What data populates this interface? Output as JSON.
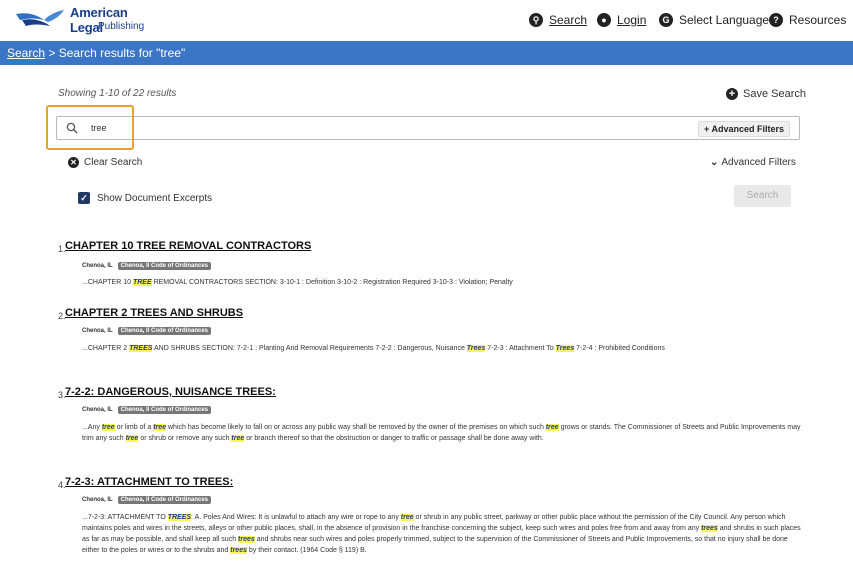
{
  "header": {
    "logo_line1": "American Legal",
    "logo_line2": "Publishing",
    "nav": {
      "search": "Search",
      "login": "Login",
      "language": "Select Language",
      "resources": "Resources"
    }
  },
  "breadcrumb": {
    "link": "Search",
    "separator": " > ",
    "current": "Search results for \"tree\""
  },
  "search": {
    "showing": "Showing 1-10 of 22 results",
    "save_label": "Save Search",
    "query": "tree",
    "advanced_filters_button": "+ Advanced Filters",
    "clear_label": "Clear Search",
    "advanced_filters_toggle": "Advanced Filters",
    "show_excerpts_label": "Show Document Excerpts",
    "show_excerpts_checked": true,
    "search_button": "Search"
  },
  "results": [
    {
      "num": "1.",
      "title": "CHAPTER 10 TREE REMOVAL CONTRACTORS",
      "place": "Chenoa, IL",
      "code": "Chenoa, Il Code of Ordinances",
      "excerpt": [
        {
          "t": "...CHAPTER 10 "
        },
        {
          "h": "TREE"
        },
        {
          "t": " REMOVAL CONTRACTORS SECTION: 3-10-1 : Definition 3-10-2 : Registration Required 3-10-3 : Violation; Penalty"
        }
      ]
    },
    {
      "num": "2.",
      "title": "CHAPTER 2 TREES AND SHRUBS",
      "place": "Chenoa, IL",
      "code": "Chenoa, Il Code of Ordinances",
      "excerpt": [
        {
          "t": "...CHAPTER 2 "
        },
        {
          "h": "TREES"
        },
        {
          "t": " AND SHRUBS SECTION: 7-2-1 : Planting And Removal Requirements 7-2-2 : Dangerous, Nuisance "
        },
        {
          "h": "Trees"
        },
        {
          "t": " 7-2-3 : Attachment To "
        },
        {
          "h": "Trees"
        },
        {
          "t": " 7-2-4 : Prohibited Conditions"
        }
      ]
    },
    {
      "num": "3.",
      "title": "7-2-2: DANGEROUS, NUISANCE TREES:",
      "place": "Chenoa, IL",
      "code": "Chenoa, Il Code of Ordinances",
      "excerpt": [
        {
          "t": "...Any "
        },
        {
          "h": "tree"
        },
        {
          "t": " or limb of a "
        },
        {
          "h": "tree"
        },
        {
          "t": " which has become likely to fall on or across any public way shall be removed by the owner of the premises on which such "
        },
        {
          "h": "tree"
        },
        {
          "t": " grows or stands. The Commissioner of Streets and Public Improvements may trim any such "
        },
        {
          "h": "tree"
        },
        {
          "t": " or shrub or remove any such "
        },
        {
          "h": "tree"
        },
        {
          "t": " or branch thereof so that the obstruction or danger to traffic or passage shall be done away with."
        }
      ]
    },
    {
      "num": "4.",
      "title": "7-2-3: ATTACHMENT TO TREES:",
      "place": "Chenoa, IL",
      "code": "Chenoa, Il Code of Ordinances",
      "excerpt": [
        {
          "t": "...7-2-3: ATTACHMENT TO "
        },
        {
          "h": "TREES"
        },
        {
          "t": ": A. Poles And Wires: It is unlawful to attach any wire or rope to any "
        },
        {
          "h": "tree"
        },
        {
          "t": " or shrub in any public street, parkway or other public place without the permission of the City Council. Any person which maintains poles and wires in the streets, alleys or other public places, shall, in the absence of provision in the franchise concerning the subject, keep such wires and poles free from and away from any "
        },
        {
          "h": "trees"
        },
        {
          "t": " and shrubs in such places as far as may be possible, and shall keep all such "
        },
        {
          "h": "trees"
        },
        {
          "t": " and shrubs near such wires and poles properly trimmed, subject to the supervision of the Commissioner of Streets and Public Improvements, so that no injury shall be done either to the poles or wires or to the shrubs and "
        },
        {
          "h": "trees"
        },
        {
          "t": " by their contact. (1964 Code § 119) B."
        }
      ]
    }
  ]
}
